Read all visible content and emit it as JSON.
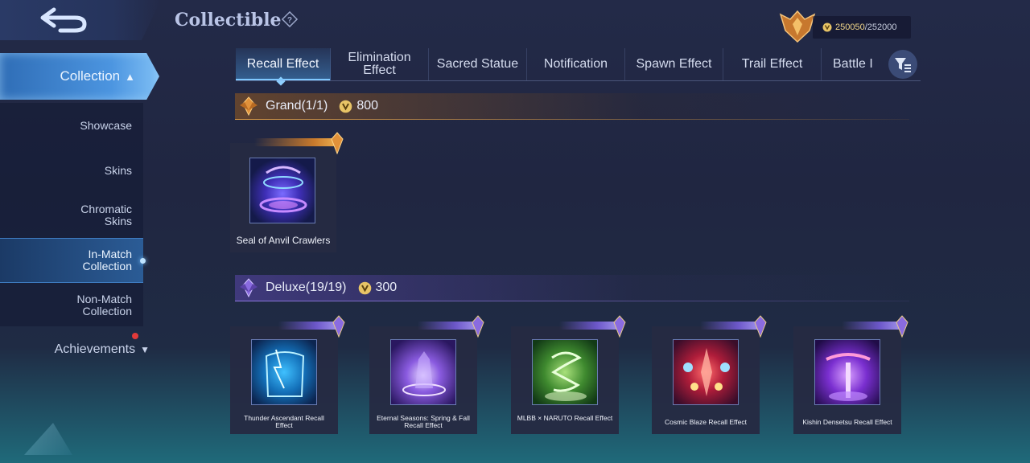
{
  "header": {
    "title": "Collectible",
    "help_icon": "question-icon",
    "currency": {
      "value": "250050",
      "max": "/252000",
      "icon": "points-coin-icon"
    }
  },
  "sidebar": {
    "collection_label": "Collection",
    "items": [
      {
        "label": "Showcase",
        "active": false
      },
      {
        "label": "Skins",
        "active": false
      },
      {
        "label": "Chromatic Skins",
        "active": false
      },
      {
        "label": "In-Match Collection",
        "active": true
      },
      {
        "label": "Non-Match Collection",
        "active": false
      }
    ],
    "achievements_label": "Achievements"
  },
  "tabs": [
    {
      "label": "Recall Effect",
      "active": true
    },
    {
      "label": "Elimination Effect",
      "active": false
    },
    {
      "label": "Sacred Statue",
      "active": false
    },
    {
      "label": "Notification",
      "active": false
    },
    {
      "label": "Spawn Effect",
      "active": false
    },
    {
      "label": "Trail Effect",
      "active": false
    },
    {
      "label": "Battle I",
      "active": false
    }
  ],
  "sections": {
    "grand": {
      "title": "Grand(1/1)",
      "price": "800",
      "accent": "#d99944",
      "items": [
        {
          "name": "Seal of Anvil Crawlers"
        }
      ]
    },
    "deluxe": {
      "title": "Deluxe(19/19)",
      "price": "300",
      "accent": "#8f78e0",
      "items": [
        {
          "name": "Thunder Ascendant Recall Effect"
        },
        {
          "name": "Eternal Seasons: Spring & Fall Recall Effect"
        },
        {
          "name": "MLBB × NARUTO Recall Effect"
        },
        {
          "name": "Cosmic Blaze Recall Effect"
        },
        {
          "name": "Kishin Densetsu Recall Effect"
        }
      ]
    }
  }
}
